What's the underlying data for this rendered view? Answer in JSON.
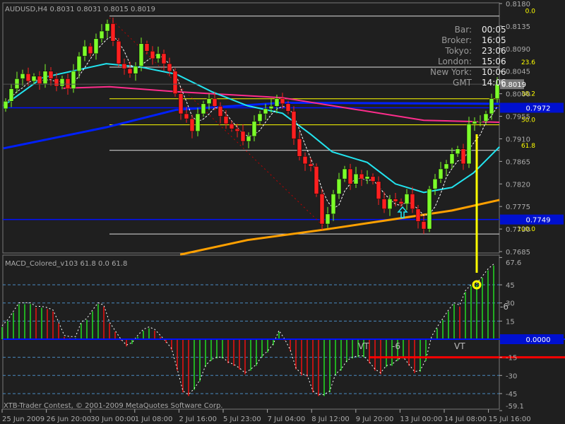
{
  "header": {
    "symbol": "AUDUSD,H4",
    "ohlc": "0.8031 0.8031 0.8015 0.8019"
  },
  "info_panel": [
    {
      "label": "Bar:",
      "value": "00:05"
    },
    {
      "label": "Broker:",
      "value": "16:05"
    },
    {
      "label": "Tokyo:",
      "value": "23:06"
    },
    {
      "label": "London:",
      "value": "15:06"
    },
    {
      "label": "New York:",
      "value": "10:06"
    },
    {
      "label": "GMT",
      "value": "14:06"
    }
  ],
  "copyright": "XTB-Trader Contest, © 2001-2009 MetaQuotes Software Corp.",
  "colors": {
    "bull": "#7cfc2a",
    "bear": "#ff2020",
    "fib": "#ffff00",
    "cyan_ma": "#22e5f0",
    "pink_ma": "#ff2d8c",
    "blue_ma": "#0020ff",
    "orange_ma": "#ffa000",
    "bg": "#1f1f1f"
  },
  "chart_data": [
    {
      "type": "candlestick",
      "title": "AUDUSD,H4",
      "ylim": [
        0.7685,
        0.818
      ],
      "y_ticks": [
        "0.8180",
        "0.8135",
        "0.8090",
        "0.8045",
        "0.8000",
        "0.7955",
        "0.7910",
        "0.7865",
        "0.7820",
        "0.7775",
        "0.7730",
        "0.7685"
      ],
      "x_ticks": [
        "25 Jun 2009",
        "26 Jun 20:00",
        "30 Jun 00:00",
        "1 Jul 08:00",
        "2 Jul 16:00",
        "5 Jul 23:00",
        "7 Jul 04:00",
        "8 Jul 12:00",
        "9 Jul 20:00",
        "13 Jul 00:00",
        "14 Jul 08:00",
        "15 Jul 16:00"
      ],
      "current_price": "0.8019",
      "closes": [
        0.7985,
        0.801,
        0.803,
        0.804,
        0.8025,
        0.8035,
        0.802,
        0.8045,
        0.803,
        0.8015,
        0.803,
        0.801,
        0.8045,
        0.8075,
        0.8095,
        0.808,
        0.811,
        0.8125,
        0.814,
        0.8105,
        0.806,
        0.805,
        0.804,
        0.8055,
        0.81,
        0.8085,
        0.807,
        0.808,
        0.806,
        0.8045,
        0.8,
        0.796,
        0.795,
        0.7925,
        0.796,
        0.798,
        0.799,
        0.7975,
        0.7955,
        0.794,
        0.793,
        0.7925,
        0.7905,
        0.7915,
        0.7945,
        0.796,
        0.797,
        0.7975,
        0.799,
        0.798,
        0.7965,
        0.791,
        0.7875,
        0.786,
        0.7855,
        0.78,
        0.774,
        0.776,
        0.78,
        0.783,
        0.785,
        0.782,
        0.784,
        0.783,
        0.7835,
        0.7825,
        0.779,
        0.777,
        0.779,
        0.7785,
        0.778,
        0.78,
        0.777,
        0.7745,
        0.773,
        0.781,
        0.783,
        0.785,
        0.786,
        0.788,
        0.789,
        0.786,
        0.794,
        0.7945,
        0.7945,
        0.796,
        0.799,
        0.8019
      ],
      "horizontal_levels": [
        {
          "price": 0.7972,
          "label": "0.7972"
        },
        {
          "price": 0.7749,
          "label": "0.7749"
        }
      ],
      "fibonacci": [
        {
          "level": "0.0",
          "price": 0.8155
        },
        {
          "level": "23.6",
          "price": 0.8053
        },
        {
          "level": "38.2",
          "price": 0.799
        },
        {
          "level": "50.0",
          "price": 0.7938
        },
        {
          "level": "61.8",
          "price": 0.7887
        },
        {
          "level": "100.0",
          "price": 0.772
        }
      ],
      "moving_averages": [
        {
          "name": "blue",
          "points": [
            [
              -0.4,
              0.7891
            ],
            [
              17.8,
              0.7933
            ],
            [
              30.2,
              0.7968
            ],
            [
              49,
              0.7982
            ],
            [
              87.4,
              0.798
            ]
          ]
        },
        {
          "name": "pink",
          "points": [
            [
              10.2,
              0.8011
            ],
            [
              18.4,
              0.8014
            ],
            [
              30.2,
              0.8004
            ],
            [
              49,
              0.7992
            ],
            [
              74,
              0.7947
            ],
            [
              87.4,
              0.7943
            ]
          ]
        },
        {
          "name": "cyan",
          "points": [
            [
              -0.4,
              0.7976
            ],
            [
              6.5,
              0.8032
            ],
            [
              17.8,
              0.806
            ],
            [
              24,
              0.8053
            ],
            [
              30.2,
              0.8039
            ],
            [
              36.5,
              0.8004
            ],
            [
              42.8,
              0.7976
            ],
            [
              49,
              0.7961
            ],
            [
              54,
              0.7919
            ],
            [
              57.8,
              0.7884
            ],
            [
              64,
              0.7863
            ],
            [
              69,
              0.782
            ],
            [
              74,
              0.7803
            ],
            [
              79,
              0.7813
            ],
            [
              82.8,
              0.7842
            ],
            [
              87.4,
              0.7894
            ]
          ]
        },
        {
          "name": "orange",
          "points": [
            [
              30.9,
              0.7679
            ],
            [
              42.8,
              0.7708
            ],
            [
              56.5,
              0.7729
            ],
            [
              69,
              0.775
            ],
            [
              79,
              0.7767
            ],
            [
              87.4,
              0.7788
            ]
          ]
        }
      ]
    },
    {
      "type": "bar",
      "title": "MACD_Colored_v103 61.8 0.0 61.8",
      "ylim": [
        -59.1,
        67.6
      ],
      "y_ticks": [
        "67.6",
        "45",
        "30",
        "15",
        "-15",
        "-30",
        "-45",
        "-59.1"
      ],
      "zero_label": "0.0000",
      "red_level": -15,
      "annotations": [
        "VT",
        "-6",
        "VT",
        "-6"
      ],
      "values": [
        10,
        15,
        22,
        29,
        29,
        29,
        26,
        26,
        25,
        23,
        13,
        2,
        1,
        1,
        13,
        16,
        23,
        29,
        27,
        13,
        6,
        -1,
        -6,
        -4,
        2,
        7,
        9,
        7,
        2,
        -3,
        -9,
        -26,
        -44,
        -47,
        -42,
        -35,
        -23,
        -18,
        -16,
        -16,
        -20,
        -22,
        -25,
        -29,
        -26,
        -22,
        -15,
        -11,
        -5,
        6,
        -1,
        -10,
        -25,
        -30,
        -31,
        -44,
        -47,
        -47,
        -44,
        -30,
        -26,
        -19,
        -16,
        -15,
        -15,
        -20,
        -26,
        -29,
        -23,
        -22,
        -18,
        -16,
        -22,
        -28,
        -27,
        -18,
        1,
        9,
        16,
        23,
        29,
        27,
        39,
        44,
        45,
        51,
        57,
        61
      ]
    }
  ]
}
